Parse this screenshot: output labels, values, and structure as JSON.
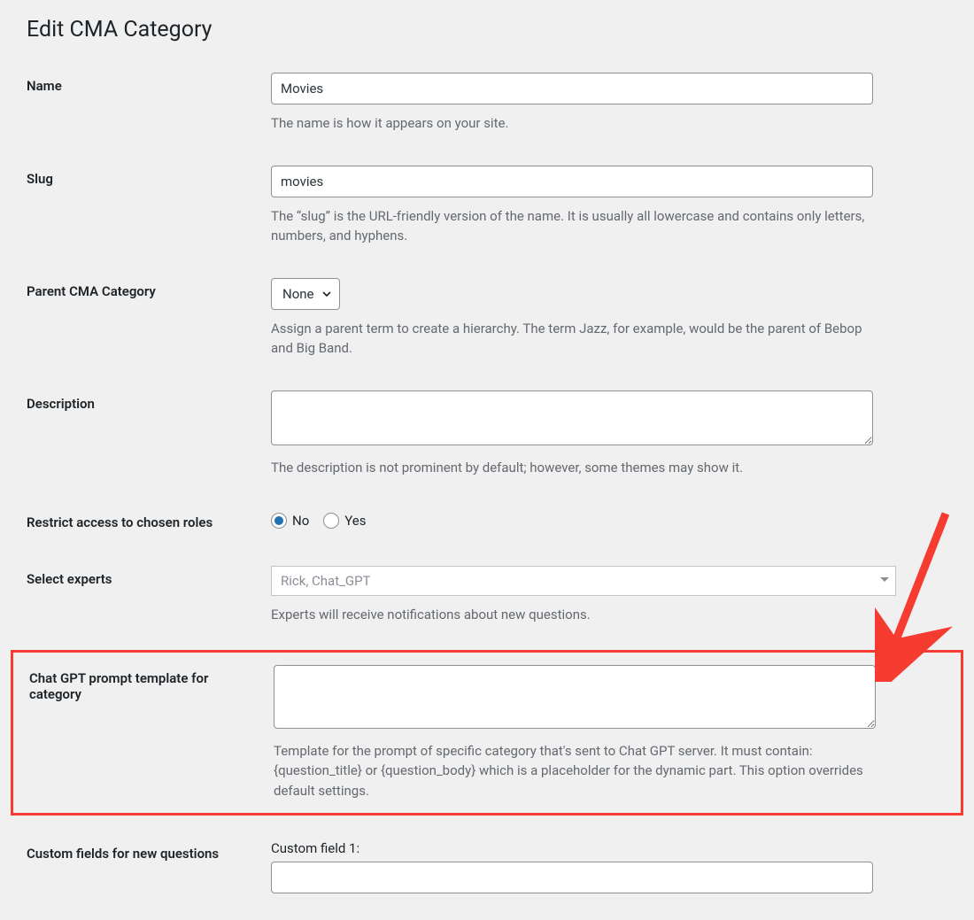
{
  "page_title": "Edit CMA Category",
  "fields": {
    "name": {
      "label": "Name",
      "value": "Movies",
      "help": "The name is how it appears on your site."
    },
    "slug": {
      "label": "Slug",
      "value": "movies",
      "help": "The “slug” is the URL-friendly version of the name. It is usually all lowercase and contains only letters, numbers, and hyphens."
    },
    "parent": {
      "label": "Parent CMA Category",
      "selected": "None",
      "help": "Assign a parent term to create a hierarchy. The term Jazz, for example, would be the parent of Bebop and Big Band."
    },
    "description": {
      "label": "Description",
      "value": "",
      "help": "The description is not prominent by default; however, some themes may show it."
    },
    "restrict": {
      "label": "Restrict access to chosen roles",
      "option_no": "No",
      "option_yes": "Yes",
      "selected": "No"
    },
    "experts": {
      "label": "Select experts",
      "value": "Rick, Chat_GPT",
      "help": "Experts will receive notifications about new questions."
    },
    "prompt_template": {
      "label": "Chat GPT prompt template for category",
      "value": "",
      "help": "Template for the prompt of specific category that's sent to Chat GPT server. It must contain: {question_title} or {question_body} which is a placeholder for the dynamic part. This option overrides default settings."
    },
    "custom_fields": {
      "label": "Custom fields for new questions",
      "field1_label": "Custom field 1:"
    }
  }
}
